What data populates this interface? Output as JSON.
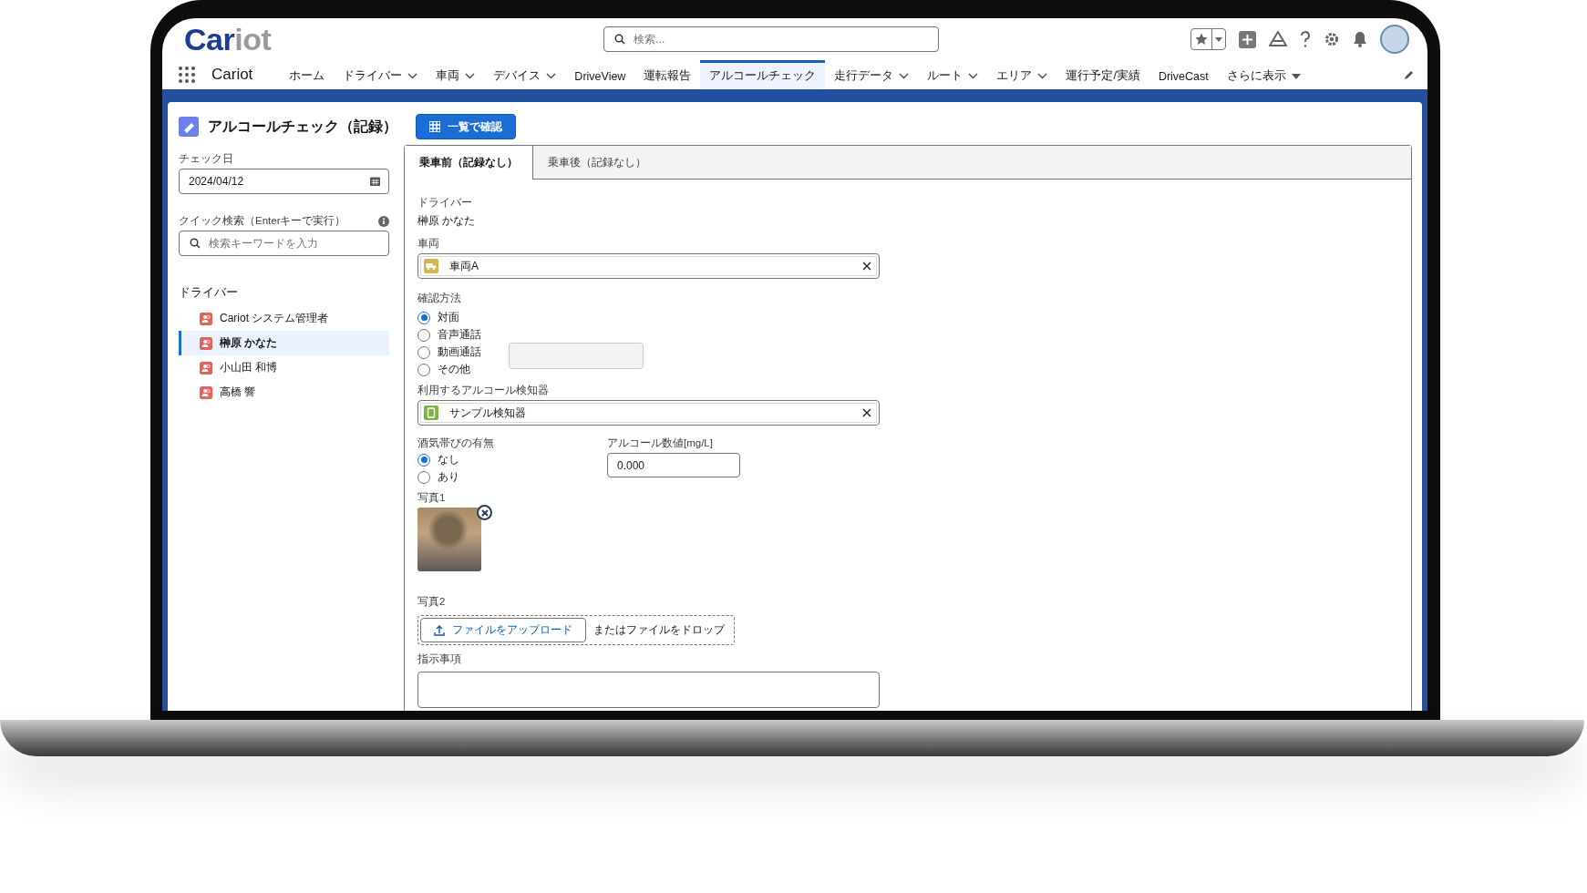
{
  "header": {
    "logo": [
      "Car",
      "iot"
    ],
    "search": {
      "placeholder": "検索..."
    },
    "app_name": "Cariot"
  },
  "nav": [
    {
      "label": "ホーム",
      "selected": false,
      "kind": "link"
    },
    {
      "label": "ドライバー",
      "selected": false,
      "kind": "menu"
    },
    {
      "label": "車両",
      "selected": false,
      "kind": "menu"
    },
    {
      "label": "デバイス",
      "selected": false,
      "kind": "menu"
    },
    {
      "label": "DriveView",
      "selected": false,
      "kind": "link"
    },
    {
      "label": "運転報告",
      "selected": false,
      "kind": "link"
    },
    {
      "label": "アルコールチェック",
      "selected": true,
      "kind": "link"
    },
    {
      "label": "走行データ",
      "selected": false,
      "kind": "menu"
    },
    {
      "label": "ルート",
      "selected": false,
      "kind": "menu"
    },
    {
      "label": "エリア",
      "selected": false,
      "kind": "menu"
    },
    {
      "label": "運行予定/実績",
      "selected": false,
      "kind": "link"
    },
    {
      "label": "DriveCast",
      "selected": false,
      "kind": "link"
    },
    {
      "label": "さらに表示",
      "selected": false,
      "kind": "more"
    }
  ],
  "page": {
    "title": "アルコールチェック（記録）",
    "list_button": "一覧で確認"
  },
  "sidebar": {
    "check_date": {
      "label": "チェック日",
      "value": "2024/04/12"
    },
    "quick_search": {
      "label": "クイック検索（Enterキーで実行）",
      "placeholder": "検索キーワードを入力"
    },
    "drivers_heading": "ドライバー",
    "drivers": [
      {
        "name": "Cariot システム管理者",
        "selected": false
      },
      {
        "name": "榊原 かなた",
        "selected": true
      },
      {
        "name": "小山田 和博",
        "selected": false
      },
      {
        "name": "高橋 響",
        "selected": false
      }
    ]
  },
  "tabs": [
    {
      "label": "乗車前（記録なし）",
      "selected": true
    },
    {
      "label": "乗車後（記録なし）",
      "selected": false
    }
  ],
  "form": {
    "driver": {
      "label": "ドライバー",
      "value": "榊原 かなた"
    },
    "vehicle": {
      "label": "車両",
      "value": "車両A"
    },
    "method": {
      "label": "確認方法",
      "options": [
        {
          "label": "対面",
          "selected": true
        },
        {
          "label": "音声通話",
          "selected": false
        },
        {
          "label": "動画通話",
          "selected": false
        },
        {
          "label": "その他",
          "selected": false
        }
      ]
    },
    "detector": {
      "label": "利用するアルコール検知器",
      "value": "サンプル検知器"
    },
    "drunk": {
      "label": "酒気帯びの有無",
      "options": [
        {
          "label": "なし",
          "selected": true
        },
        {
          "label": "あり",
          "selected": false
        }
      ]
    },
    "alcohol": {
      "label": "アルコール数値[mg/L]",
      "value": "0.000"
    },
    "photo1": {
      "label": "写真1"
    },
    "photo2": {
      "label": "写真2",
      "upload_button": "ファイルをアップロード",
      "drop_text": "またはファイルをドロップ"
    },
    "instructions": {
      "label": "指示事項"
    }
  }
}
